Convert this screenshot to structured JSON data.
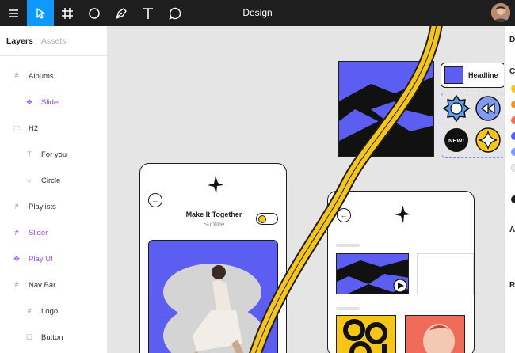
{
  "app": {
    "title": "Design"
  },
  "toolbar": {
    "tools": [
      "menu-icon",
      "move-icon",
      "frame-icon",
      "ellipse-icon",
      "pen-icon",
      "text-icon",
      "comment-icon"
    ]
  },
  "layers_panel": {
    "tabs": [
      {
        "label": "Layers",
        "active": true
      },
      {
        "label": "Assets",
        "active": false
      }
    ],
    "items": [
      {
        "label": "Albums",
        "icon": "frame-icon",
        "purple": false
      },
      {
        "label": "Slider",
        "icon": "component-icon",
        "purple": true
      },
      {
        "label": "H2",
        "icon": "frame-icon",
        "purple": false
      },
      {
        "label": "For you",
        "icon": "text-icon",
        "purple": false
      },
      {
        "label": "Circle",
        "icon": "circle-icon",
        "purple": false
      },
      {
        "label": "Playlists",
        "icon": "frame-icon",
        "purple": false
      },
      {
        "label": "Slider",
        "icon": "frame-icon",
        "purple": true
      },
      {
        "label": "Play UI",
        "icon": "component-icon",
        "purple": true
      },
      {
        "label": "Nav Bar",
        "icon": "frame-icon",
        "purple": false
      },
      {
        "label": "Logo",
        "icon": "frame-icon",
        "purple": false
      },
      {
        "label": "Button",
        "icon": "frame-icon",
        "purple": false
      }
    ]
  },
  "right_panel": {
    "letters": [
      "D",
      "C",
      "A",
      "R"
    ],
    "swatches": [
      "#f5c518",
      "#f0962e",
      "#ef6b5a",
      "#5b5ef0",
      "#7f9bf5",
      "#ececec",
      "#1e1e1e"
    ]
  },
  "canvas": {
    "phone1": {
      "title": "Make It Together",
      "subtitle": "Subtitle",
      "toggle_on": true
    },
    "headline_card": {
      "label": "Headline"
    },
    "badges": [
      {
        "name": "star-badge",
        "label": ""
      },
      {
        "name": "rewind-badge",
        "label": ""
      },
      {
        "name": "new-badge",
        "label": "NEW!"
      },
      {
        "name": "sparkle-badge",
        "label": ""
      }
    ],
    "colors": {
      "accent": "#5b5ef0",
      "yellow": "#f5c518",
      "dark": "#1e1e1e",
      "selection": "#0d99ff"
    }
  }
}
